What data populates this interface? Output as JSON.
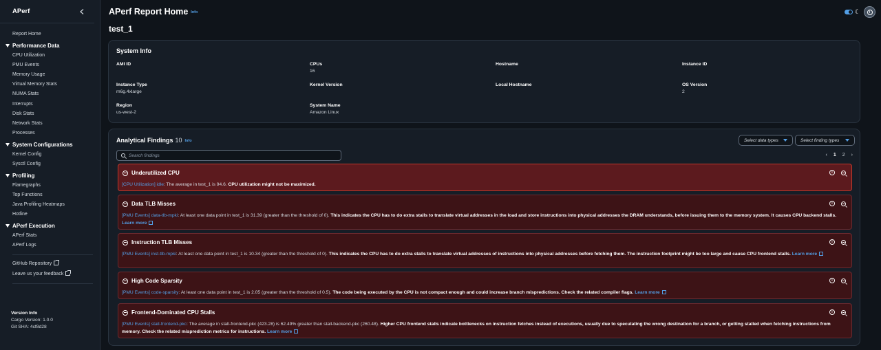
{
  "app": {
    "title": "APerf"
  },
  "sidebar": {
    "home": "Report Home",
    "sections": [
      {
        "label": "Performance Data",
        "items": [
          "CPU Utilization",
          "PMU Events",
          "Memory Usage",
          "Virtual Memory Stats",
          "NUMA Stats",
          "Interrupts",
          "Disk Stats",
          "Network Stats",
          "Processes"
        ]
      },
      {
        "label": "System Configurations",
        "items": [
          "Kernel Config",
          "Sysctl Config"
        ]
      },
      {
        "label": "Profiling",
        "items": [
          "Flamegraphs",
          "Top Functions",
          "Java Profiling Heatmaps",
          "Hotline"
        ]
      },
      {
        "label": "APerf Execution",
        "items": [
          "APerf Stats",
          "APerf Logs"
        ]
      }
    ],
    "github": "GitHub Repository",
    "feedback": "Leave us your feedback",
    "version": {
      "heading": "Version Info",
      "cargo": "Cargo Version: 1.0.0",
      "git": "Git SHA: 4cf8d28"
    }
  },
  "header": {
    "title": "APerf Report Home",
    "info": "Info",
    "run": "test_1"
  },
  "system_info": {
    "title": "System Info",
    "fields": [
      {
        "label": "AMI ID",
        "value": ""
      },
      {
        "label": "CPUs",
        "value": "16"
      },
      {
        "label": "Hostname",
        "value": ""
      },
      {
        "label": "Instance ID",
        "value": ""
      },
      {
        "label": "Instance Type",
        "value": "m6g.4xlarge"
      },
      {
        "label": "Kernel Version",
        "value": ""
      },
      {
        "label": "Local Hostname",
        "value": ""
      },
      {
        "label": "OS Version",
        "value": "2"
      },
      {
        "label": "Region",
        "value": "us-west-2"
      },
      {
        "label": "System Name",
        "value": "Amazon Linux"
      }
    ]
  },
  "findings": {
    "title": "Analytical Findings",
    "count": "10",
    "info": "Info",
    "search_placeholder": "Search findings",
    "filter_data": "Select data types",
    "filter_finding": "Select finding types",
    "pages": [
      "1",
      "2"
    ],
    "learn_more": "Learn more",
    "items": [
      {
        "title": "Underutilized CPU",
        "source": "[CPU Utilization] idle",
        "text": ": The average in test_1 is 94.6. ",
        "bold": "CPU utilization might not be maximized.",
        "learn": ""
      },
      {
        "title": "Data TLB Misses",
        "source": "[PMU Events] data-tlb-mpki",
        "text": ": At least one data point in test_1 is 31.39 (greater than the threshold of 0). ",
        "bold": "This indicates the CPU has to do extra stalls to translate virtual addresses in the load and store instructions into physical addresses the DRAM understands, before issuing them to the memory system. It causes CPU backend stalls.",
        "learn": "Learn more"
      },
      {
        "title": "Instruction TLB Misses",
        "source": "[PMU Events] inst-tlb-mpki",
        "text": ": At least one data point in test_1 is 10.34 (greater than the threshold of 0). ",
        "bold": "This indicates the CPU has to do extra stalls to translate virtual addresses of instructions into physical addresses before fetching them. The instruction footprint might be too large and cause CPU frontend stalls.",
        "learn": "Learn more"
      },
      {
        "title": "High Code Sparsity",
        "source": "[PMU Events] code-sparsity",
        "text": ": At least one data point in test_1 is 2.05 (greater than the threshold of 0.5). ",
        "bold": "The code being executed by the CPU is not compact enough and could increase branch mispredictions. Check the related compiler flags.",
        "learn": "Learn more"
      },
      {
        "title": "Frontend-Dominated CPU Stalls",
        "source": "[PMU Events] stall-frontend-pkc",
        "text": ": The average in stall-frontend-pkc (423.28) is 62.49% greater than stall-backend-pkc (260.48). ",
        "bold": "Higher CPU frontend stalls indicate bottlenecks on instruction fetches instead of executions, usually due to speculating the wrong destination for a branch, or getting stalled when fetching instructions from memory. Check the related misprediction metrics for instructions.",
        "learn": "Learn more"
      }
    ]
  }
}
